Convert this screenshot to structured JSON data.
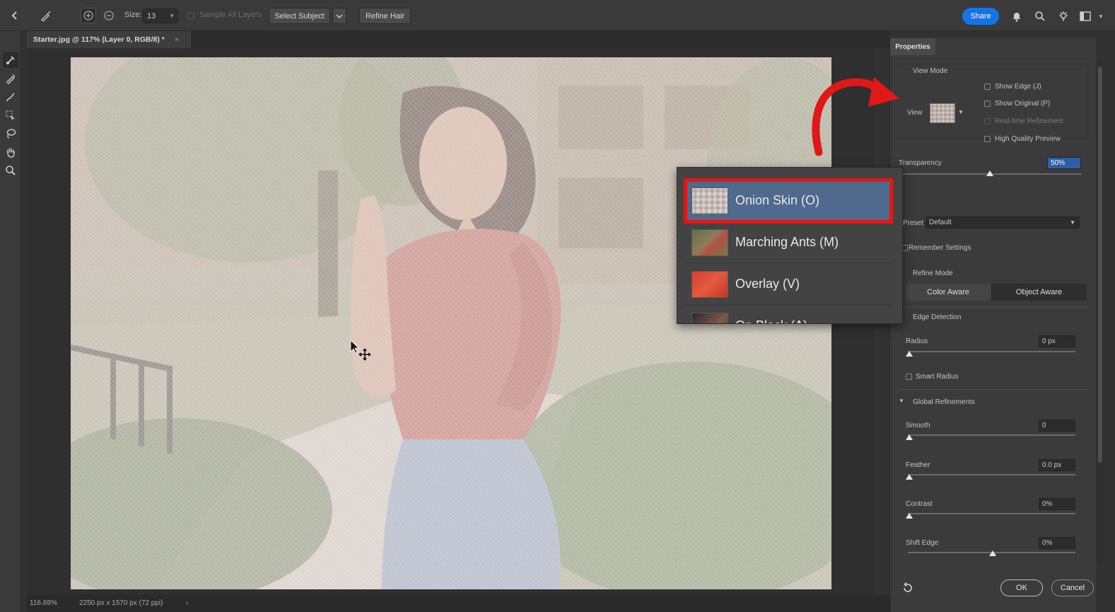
{
  "options_bar": {
    "size_label": "Size:",
    "size_value": "13",
    "sample_all_layers": "Sample All Layers",
    "select_subject": "Select Subject",
    "refine_hair": "Refine Hair",
    "share": "Share"
  },
  "document_tab": {
    "title": "Starter.jpg @ 117% (Layer 0, RGB/8) *",
    "close": "×"
  },
  "status_bar": {
    "zoom": "116.69%",
    "dimensions": "2250 px x 1570 px (72 ppi)",
    "more": "›"
  },
  "properties": {
    "header": "Properties",
    "view_mode_title": "View Mode",
    "view_label": "View",
    "show_edge": "Show Edge (J)",
    "show_original": "Show Original (P)",
    "real_time_refinement": "Real-time Refinement",
    "high_quality_preview": "High Quality Preview",
    "transparency_label": "Transparency",
    "transparency_value": "50%",
    "transparency_level": 0.5,
    "preset_label": "Preset",
    "preset_value": "Default",
    "remember_settings": "Remember Settings",
    "refine_mode_title": "Refine Mode",
    "color_aware": "Color Aware",
    "object_aware": "Object Aware",
    "edge_detection_title": "Edge Detection",
    "radius_label": "Radius",
    "radius_value": "0 px",
    "smart_radius": "Smart Radius",
    "global_refinements_title": "Global Refinements",
    "smooth_label": "Smooth",
    "smooth_value": "0",
    "feather_label": "Feather",
    "feather_value": "0.0 px",
    "contrast_label": "Contrast",
    "contrast_value": "0%",
    "shift_edge_label": "Shift Edge",
    "shift_edge_value": "0%",
    "ok": "OK",
    "cancel": "Cancel"
  },
  "view_dropdown": {
    "items": [
      {
        "label": "Onion Skin (O)",
        "selected": true
      },
      {
        "label": "Marching Ants (M)",
        "selected": false
      },
      {
        "label": "Overlay (V)",
        "selected": false
      },
      {
        "label": "On Black (A)",
        "selected": false
      }
    ]
  },
  "colors": {
    "accent_blue": "#1473e6",
    "highlight_red": "#e01818",
    "panel_bg": "#3b3b3b",
    "app_bg": "#323232"
  },
  "icons": {
    "back": "chevron-left-icon",
    "brush": "brush-icon",
    "add": "plus-circle-icon",
    "subtract": "minus-circle-icon",
    "bell": "bell-icon",
    "search": "search-icon",
    "lightbulb": "lightbulb-icon",
    "workspace": "workspace-icon",
    "reset": "reset-icon"
  }
}
